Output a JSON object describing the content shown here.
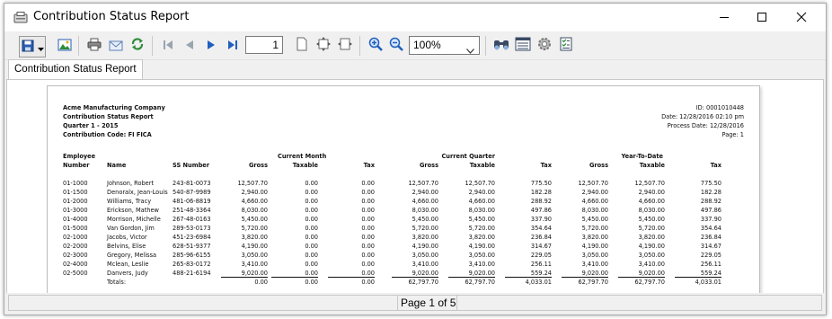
{
  "window": {
    "title": "Contribution Status Report",
    "controls": {
      "minimize": "minimize-icon",
      "maximize": "maximize-icon",
      "close": "close-icon"
    }
  },
  "toolbar": {
    "buttons": [
      "save-icon",
      "dropdown-arrow-icon",
      "export-image-icon",
      "print-icon",
      "email-icon",
      "refresh-icon",
      "first-page-icon",
      "previous-page-icon",
      "next-page-icon",
      "last-page-icon",
      "single-page-icon",
      "fit-page-icon",
      "fit-width-icon",
      "zoom-in-icon",
      "zoom-out-icon",
      "find-icon",
      "group-tree-icon",
      "settings-icon",
      "parameters-icon"
    ],
    "page_number": "1",
    "zoom": "100%"
  },
  "tabs": [
    {
      "label": "Contribution Status Report"
    }
  ],
  "report": {
    "header_left": [
      "Acme Manufacturing Company",
      "Contribution Status Report",
      "Quarter 1 - 2015",
      "Contribution Code: FI FICA"
    ],
    "header_right": [
      "ID: 0001010448",
      "Date: 12/28/2016 02:10 pm",
      "Process Date: 12/28/2016",
      "Page: 1"
    ],
    "group_headers": {
      "current_month": "Current Month",
      "current_quarter": "Current Quarter",
      "year_to_date": "Year-To-Date"
    },
    "col_headers": {
      "employee_line1": "Employee",
      "employee_line2": "Number",
      "name": "Name",
      "ss_number": "SS Number",
      "gross": "Gross",
      "taxable": "Taxable",
      "tax": "Tax"
    },
    "rows": [
      [
        "01-1000",
        "Johnson, Robert",
        "243-81-0073",
        "12,507.70",
        "0.00",
        "0.00",
        "12,507.70",
        "12,507.70",
        "775.50",
        "12,507.70",
        "12,507.70",
        "775.50"
      ],
      [
        "01-1500",
        "Denoralx, Jean-Louis",
        "540-87-9989",
        "2,940.00",
        "0.00",
        "0.00",
        "2,940.00",
        "2,940.00",
        "182.28",
        "2,940.00",
        "2,940.00",
        "182.28"
      ],
      [
        "01-2000",
        "Williams, Tracy",
        "481-06-8819",
        "4,660.00",
        "0.00",
        "0.00",
        "4,660.00",
        "4,660.00",
        "288.92",
        "4,660.00",
        "4,660.00",
        "288.92"
      ],
      [
        "01-3000",
        "Erickson, Mathew",
        "251-48-3364",
        "8,030.00",
        "0.00",
        "0.00",
        "8,030.00",
        "8,030.00",
        "497.86",
        "8,030.00",
        "8,030.00",
        "497.86"
      ],
      [
        "01-4000",
        "Morrison, Michelle",
        "267-48-0163",
        "5,450.00",
        "0.00",
        "0.00",
        "5,450.00",
        "5,450.00",
        "337.90",
        "5,450.00",
        "5,450.00",
        "337.90"
      ],
      [
        "01-5000",
        "Van Gordon, Jim",
        "289-53-0173",
        "5,720.00",
        "0.00",
        "0.00",
        "5,720.00",
        "5,720.00",
        "354.64",
        "5,720.00",
        "5,720.00",
        "354.64"
      ],
      [
        "02-1000",
        "Jacobs, Victor",
        "451-23-6984",
        "3,820.00",
        "0.00",
        "0.00",
        "3,820.00",
        "3,820.00",
        "236.84",
        "3,820.00",
        "3,820.00",
        "236.84"
      ],
      [
        "02-2000",
        "Belvins, Elise",
        "628-51-9377",
        "4,190.00",
        "0.00",
        "0.00",
        "4,190.00",
        "4,190.00",
        "314.67",
        "4,190.00",
        "4,190.00",
        "314.67"
      ],
      [
        "02-3000",
        "Gregory, Melissa",
        "285-96-6155",
        "3,050.00",
        "0.00",
        "0.00",
        "3,050.00",
        "3,050.00",
        "229.05",
        "3,050.00",
        "3,050.00",
        "229.05"
      ],
      [
        "02-4000",
        "Mclean, Leslie",
        "265-83-0172",
        "3,410.00",
        "0.00",
        "0.00",
        "3,410.00",
        "3,410.00",
        "256.11",
        "3,410.00",
        "3,410.00",
        "256.11"
      ],
      [
        "02-5000",
        "Danvers, Judy",
        "488-21-6194",
        "9,020.00",
        "0.00",
        "0.00",
        "9,020.00",
        "9,020.00",
        "559.24",
        "9,020.00",
        "9,020.00",
        "559.24"
      ]
    ],
    "totals_label": "Totals:",
    "totals": [
      "0.00",
      "0.00",
      "0.00",
      "62,797.70",
      "62,797.70",
      "4,033.01",
      "62,797.70",
      "62,797.70",
      "4,033.01"
    ]
  },
  "status": {
    "page_text": "Page 1 of 5"
  },
  "colors": {
    "accent_blue": "#1f5fbf",
    "nav_disabled": "#9aa3b0",
    "refresh_green": "#2e8b3a"
  }
}
